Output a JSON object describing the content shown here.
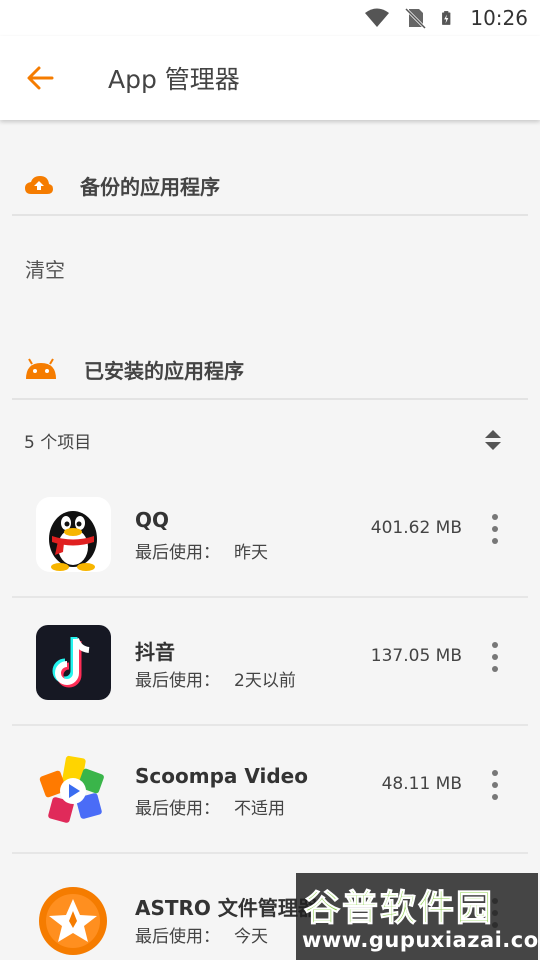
{
  "status_bar": {
    "time": "10:26",
    "icons": [
      "wifi-icon",
      "no-sim-icon",
      "battery-charging-icon"
    ]
  },
  "app_bar": {
    "back_icon": "arrow-left-icon",
    "title": "App 管理器"
  },
  "backup_section": {
    "icon": "cloud-upload-icon",
    "title": "备份的应用程序",
    "clear_label": "清空"
  },
  "installed_section": {
    "icon": "android-icon",
    "title": "已安装的应用程序",
    "count_text": "5 个项目",
    "sort_icon": "sort-updown-icon"
  },
  "apps": [
    {
      "name": "QQ",
      "usage_label": "最后使用：",
      "usage_value": "昨天",
      "size": "401.62 MB",
      "icon": "qq-penguin-icon"
    },
    {
      "name": "抖音",
      "usage_label": "最后使用：",
      "usage_value": "2天以前",
      "size": "137.05 MB",
      "icon": "tiktok-note-icon"
    },
    {
      "name": "Scoompa Video",
      "usage_label": "最后使用：",
      "usage_value": "不适用",
      "size": "48.11 MB",
      "icon": "scoompa-play-icon"
    },
    {
      "name": "ASTRO 文件管理器",
      "usage_label": "最后使用：",
      "usage_value": "今天",
      "size": "",
      "icon": "astro-star-icon"
    }
  ],
  "watermark": {
    "title": "谷普软件园",
    "url": "www.gupuxiazai.com"
  },
  "colors": {
    "accent": "#f57c00",
    "background": "#f5f5f5",
    "divider": "#e3e3e3"
  }
}
